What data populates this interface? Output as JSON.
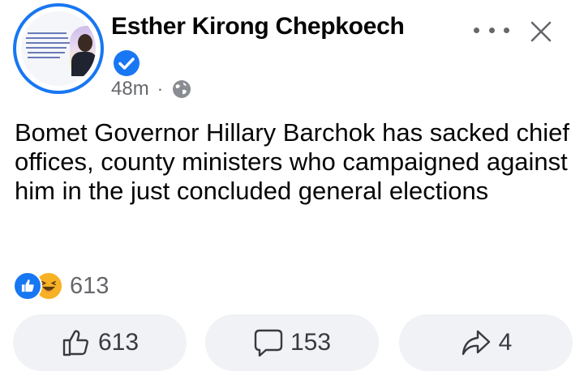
{
  "post": {
    "author": "Esther Kirong Chepkoech",
    "time": "48m",
    "separator": "·",
    "text": "Bomet Governor Hillary Barchok has sacked chief offices, county ministers who campaigned against him in the just concluded general elections",
    "reaction_count": "613"
  },
  "actions": {
    "like_count": "613",
    "comment_count": "153",
    "share_count": "4"
  },
  "icons": {
    "verified": "verified-badge-icon",
    "privacy": "globe-icon",
    "more": "more-options-icon",
    "close": "close-icon",
    "like": "thumbs-up-icon",
    "comment": "comment-bubble-icon",
    "share": "share-arrow-icon",
    "reaction_like": "like-reaction-icon",
    "reaction_haha": "haha-reaction-icon"
  },
  "colors": {
    "accent": "#1877f2",
    "text": "#050505",
    "secondary": "#65676b",
    "button_bg": "#f0f2f5"
  }
}
